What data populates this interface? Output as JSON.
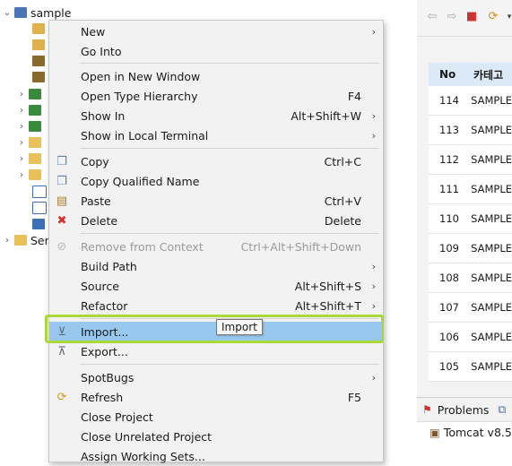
{
  "explorer": {
    "root_label": "sample",
    "second_root_label": "Ser"
  },
  "editor": {
    "table": {
      "headers": [
        "No",
        "카테고"
      ],
      "rows": [
        {
          "no": "114",
          "category": "SAMPLE"
        },
        {
          "no": "113",
          "category": "SAMPLE"
        },
        {
          "no": "112",
          "category": "SAMPLE"
        },
        {
          "no": "111",
          "category": "SAMPLE"
        },
        {
          "no": "110",
          "category": "SAMPLE"
        },
        {
          "no": "109",
          "category": "SAMPLE"
        },
        {
          "no": "108",
          "category": "SAMPLE"
        },
        {
          "no": "107",
          "category": "SAMPLE"
        },
        {
          "no": "106",
          "category": "SAMPLE"
        },
        {
          "no": "105",
          "category": "SAMPLE"
        }
      ]
    }
  },
  "bottom_panel": {
    "tab_label": "Problems",
    "server_item": "Tomcat v8.5"
  },
  "context_menu": {
    "items": [
      {
        "label": "New",
        "accel": "",
        "submenu": true
      },
      {
        "label": "Go Into",
        "accel": "",
        "submenu": false
      },
      {
        "label": "Open in New Window",
        "accel": "",
        "submenu": false
      },
      {
        "label": "Open Type Hierarchy",
        "accel": "F4",
        "submenu": false
      },
      {
        "label": "Show In",
        "accel": "Alt+Shift+W",
        "submenu": true
      },
      {
        "label": "Show in Local Terminal",
        "accel": "",
        "submenu": true
      },
      {
        "label": "Copy",
        "accel": "Ctrl+C",
        "submenu": false
      },
      {
        "label": "Copy Qualified Name",
        "accel": "",
        "submenu": false
      },
      {
        "label": "Paste",
        "accel": "Ctrl+V",
        "submenu": false
      },
      {
        "label": "Delete",
        "accel": "Delete",
        "submenu": false
      },
      {
        "label": "Remove from Context",
        "accel": "Ctrl+Alt+Shift+Down",
        "submenu": false,
        "disabled": true
      },
      {
        "label": "Build Path",
        "accel": "",
        "submenu": true
      },
      {
        "label": "Source",
        "accel": "Alt+Shift+S",
        "submenu": true
      },
      {
        "label": "Refactor",
        "accel": "Alt+Shift+T",
        "submenu": true
      },
      {
        "label": "Import...",
        "accel": "",
        "submenu": false,
        "selected": true
      },
      {
        "label": "Export...",
        "accel": "",
        "submenu": false
      },
      {
        "label": "SpotBugs",
        "accel": "",
        "submenu": true
      },
      {
        "label": "Refresh",
        "accel": "F5",
        "submenu": false
      },
      {
        "label": "Close Project",
        "accel": "",
        "submenu": false
      },
      {
        "label": "Close Unrelated Project",
        "accel": "",
        "submenu": false
      },
      {
        "label": "Assign Working Sets...",
        "accel": "",
        "submenu": false
      }
    ]
  },
  "tooltip": {
    "text": "Import"
  },
  "colors": {
    "selection": "#98c8ee",
    "highlight_box": "#a9d83a",
    "menu_background": "#f2f2f2",
    "table_header": "#dce9f6"
  }
}
